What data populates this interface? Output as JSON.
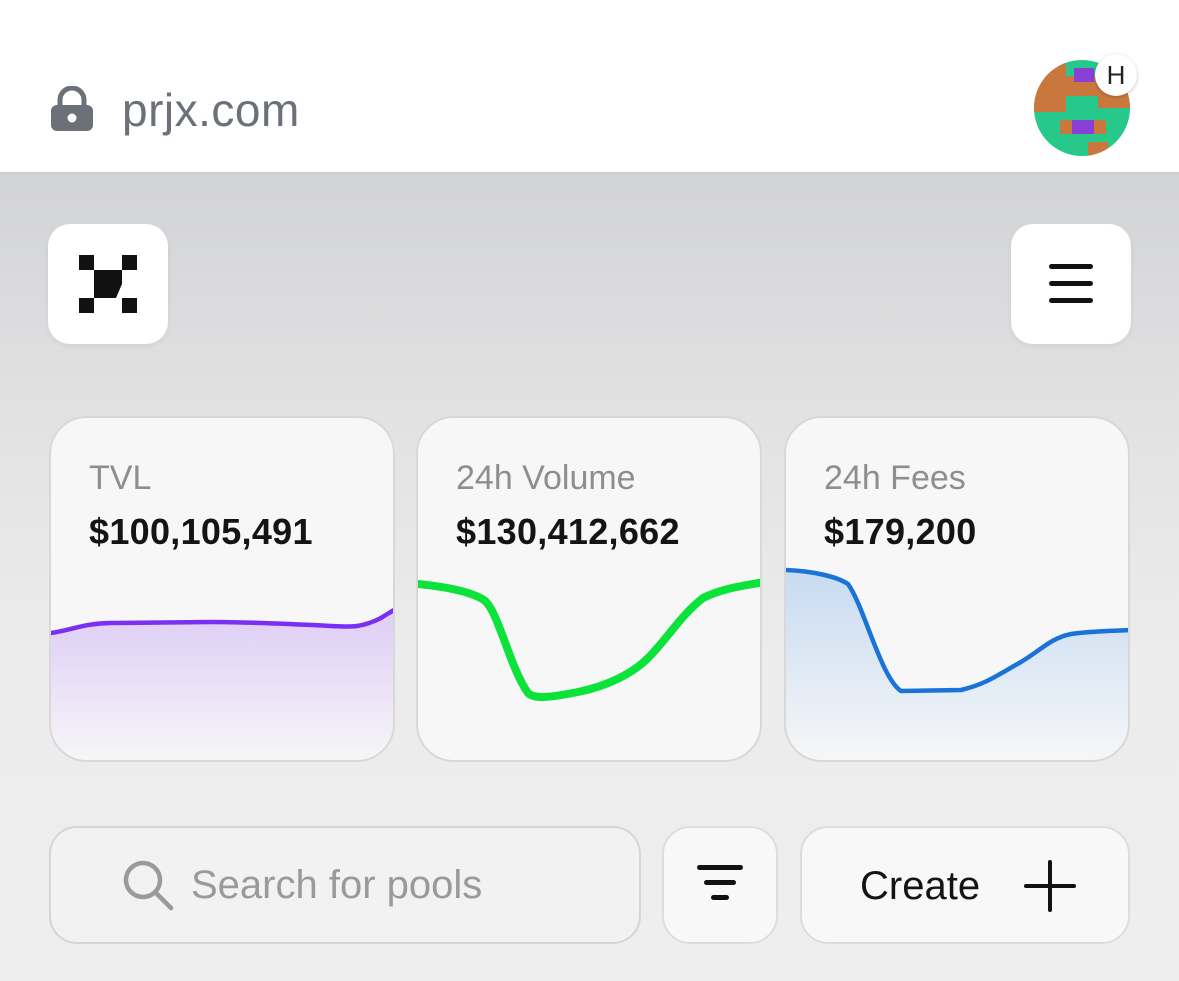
{
  "browser": {
    "url": "prjx.com",
    "profile_badge": "H",
    "icons": [
      "lock-icon",
      "avatar"
    ]
  },
  "header": {
    "logo_icon": "prjx-logo-icon",
    "menu_icon": "hamburger-menu-icon"
  },
  "stats": [
    {
      "label": "TVL",
      "value": "$100,105,491",
      "color": "#7b2ff2",
      "fill": "#c9a9f5"
    },
    {
      "label": "24h Volume",
      "value": "$130,412,662",
      "color": "#0be33a",
      "fill": "none"
    },
    {
      "label": "24h Fees",
      "value": "$179,200",
      "color": "#1a73d8",
      "fill": "#a8c8ee"
    }
  ],
  "toolbar": {
    "search_placeholder": "Search for pools",
    "filter_icon": "filter-icon",
    "create_label": "Create",
    "create_icon": "plus-icon"
  },
  "colors": {
    "url_text": "#6b7079",
    "card_background": "#f7f7f7",
    "page_background": "#e2e2e3"
  }
}
